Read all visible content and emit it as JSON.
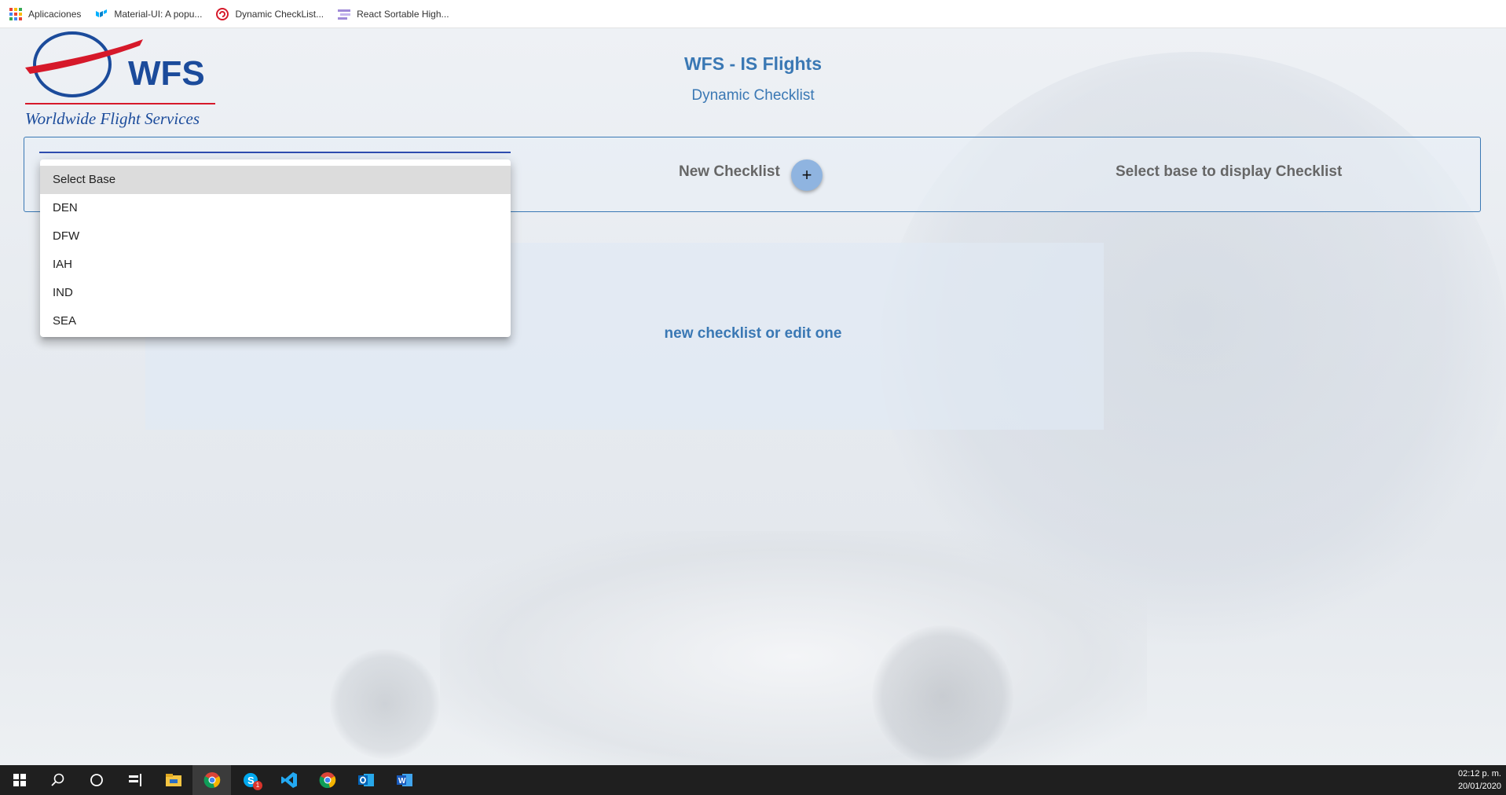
{
  "bookmarks": [
    {
      "label": "Aplicaciones",
      "icon": "apps-grid-icon"
    },
    {
      "label": "Material-UI: A popu...",
      "icon": "material-ui-icon"
    },
    {
      "label": "Dynamic CheckList...",
      "icon": "dynamic-checklist-icon"
    },
    {
      "label": "React Sortable High...",
      "icon": "react-sortable-icon"
    }
  ],
  "logo": {
    "brand": "WFS",
    "tagline": "Worldwide Flight Services"
  },
  "header": {
    "title": "WFS - IS Flights",
    "subtitle": "Dynamic Checklist"
  },
  "controls": {
    "new_checklist_label": "New Checklist",
    "add_icon": "+",
    "display_hint": "Select base to display Checklist"
  },
  "base_select": {
    "options": [
      "Select Base",
      "DEN",
      "DFW",
      "IAH",
      "IND",
      "SEA"
    ],
    "highlighted": "Select Base"
  },
  "info": {
    "message": "new checklist or edit one"
  },
  "taskbar": {
    "icons": [
      "windows-start-icon",
      "search-icon",
      "cortana-icon",
      "task-view-icon",
      "file-explorer-icon",
      "chrome-icon",
      "skype-icon",
      "vscode-icon",
      "chrome-icon",
      "outlook-icon",
      "word-icon"
    ],
    "time": "02:12 p. m.",
    "date": "20/01/2020",
    "skype_badge": "1"
  },
  "colors": {
    "accent": "#3a78b4",
    "logo_blue": "#1b4b9b",
    "logo_red": "#d6192a",
    "fab": "#8fb4e0"
  }
}
